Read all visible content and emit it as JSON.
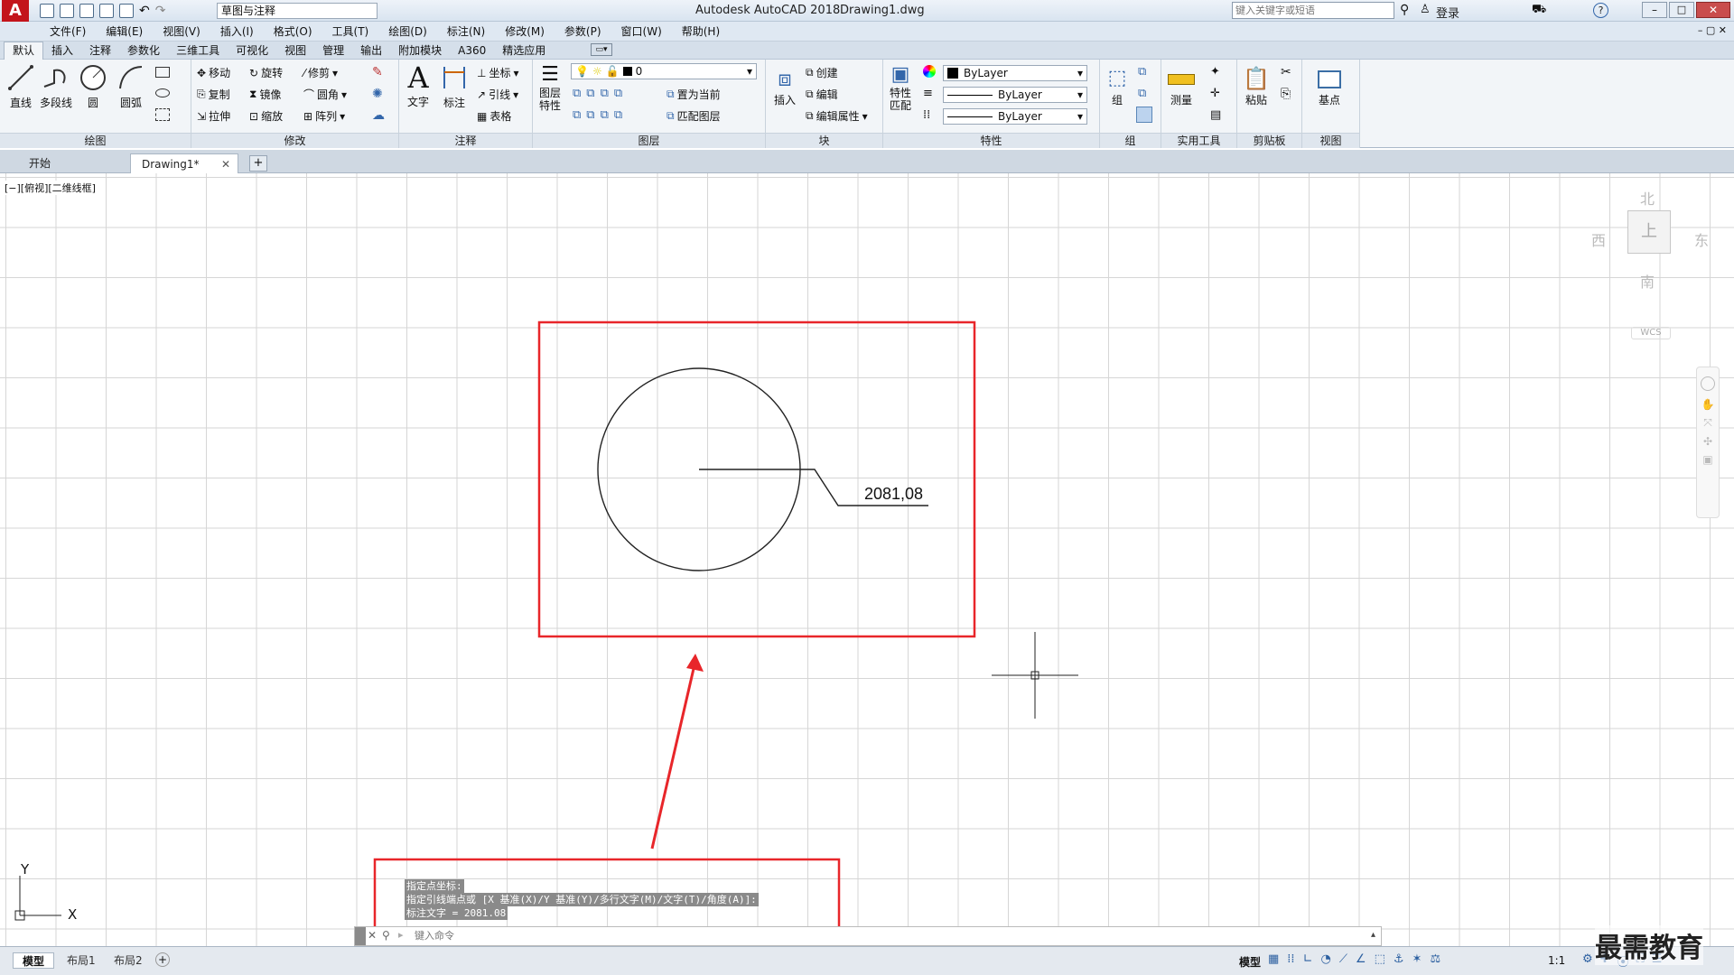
{
  "titlebar": {
    "workspace": "草图与注释",
    "app_title": "Autodesk AutoCAD 2018",
    "file_title": "Drawing1.dwg",
    "search_placeholder": "键入关键字或短语",
    "login": "登录",
    "help": "?"
  },
  "menu": [
    "文件(F)",
    "编辑(E)",
    "视图(V)",
    "插入(I)",
    "格式(O)",
    "工具(T)",
    "绘图(D)",
    "标注(N)",
    "修改(M)",
    "参数(P)",
    "窗口(W)",
    "帮助(H)"
  ],
  "ribbon_tabs": [
    "默认",
    "插入",
    "注释",
    "参数化",
    "三维工具",
    "可视化",
    "视图",
    "管理",
    "输出",
    "附加模块",
    "A360",
    "精选应用"
  ],
  "panels": {
    "draw": {
      "label": "绘图",
      "line": "直线",
      "polyline": "多段线",
      "circle": "圆",
      "arc": "圆弧"
    },
    "modify": {
      "label": "修改",
      "move": "移动",
      "rotate": "旋转",
      "trim": "修剪",
      "copy": "复制",
      "mirror": "镜像",
      "fillet": "圆角",
      "stretch": "拉伸",
      "scale": "缩放",
      "array": "阵列"
    },
    "annotation": {
      "label": "注释",
      "text": "文字",
      "dim": "标注",
      "coord": "坐标",
      "leader": "引线",
      "table": "表格"
    },
    "layers": {
      "label": "图层",
      "props": "图层\n特性",
      "current_layer": "0",
      "make_current": "置为当前",
      "match": "匹配图层"
    },
    "block": {
      "label": "块",
      "insert": "插入",
      "create": "创建",
      "edit": "编辑",
      "edit_attr": "编辑属性"
    },
    "properties": {
      "label": "特性",
      "match": "特性\n匹配",
      "color": "ByLayer",
      "linetype": "ByLayer",
      "lineweight": "ByLayer"
    },
    "groups": {
      "label": "组",
      "group": "组"
    },
    "utilities": {
      "label": "实用工具",
      "measure": "测量"
    },
    "clipboard": {
      "label": "剪贴板",
      "paste": "粘贴"
    },
    "view": {
      "label": "视图",
      "base": "基点"
    }
  },
  "doc_tabs": {
    "start": "开始",
    "drawing": "Drawing1*"
  },
  "viewport": {
    "label": "[−][俯视][二维线框]",
    "compass": {
      "n": "北",
      "s": "南",
      "e": "东",
      "w": "西",
      "top": "上",
      "wcs": "WCS"
    }
  },
  "drawing": {
    "dim_text": "2081,08"
  },
  "command": {
    "lines": [
      "指定点坐标:",
      "指定引线端点或 [X 基准(X)/Y 基准(Y)/多行文字(M)/文字(T)/角度(A)]:",
      "标注文字 = 2081.08"
    ],
    "prompt": "键入命令"
  },
  "ucs": {
    "x": "X",
    "y": "Y"
  },
  "status": {
    "model_tab": "模型",
    "layout1": "布局1",
    "layout2": "布局2",
    "model": "模型",
    "scale": "1:1"
  },
  "watermark": "最需教育",
  "colors": {
    "highlight": "#e8262a",
    "app_red": "#c3141b"
  }
}
